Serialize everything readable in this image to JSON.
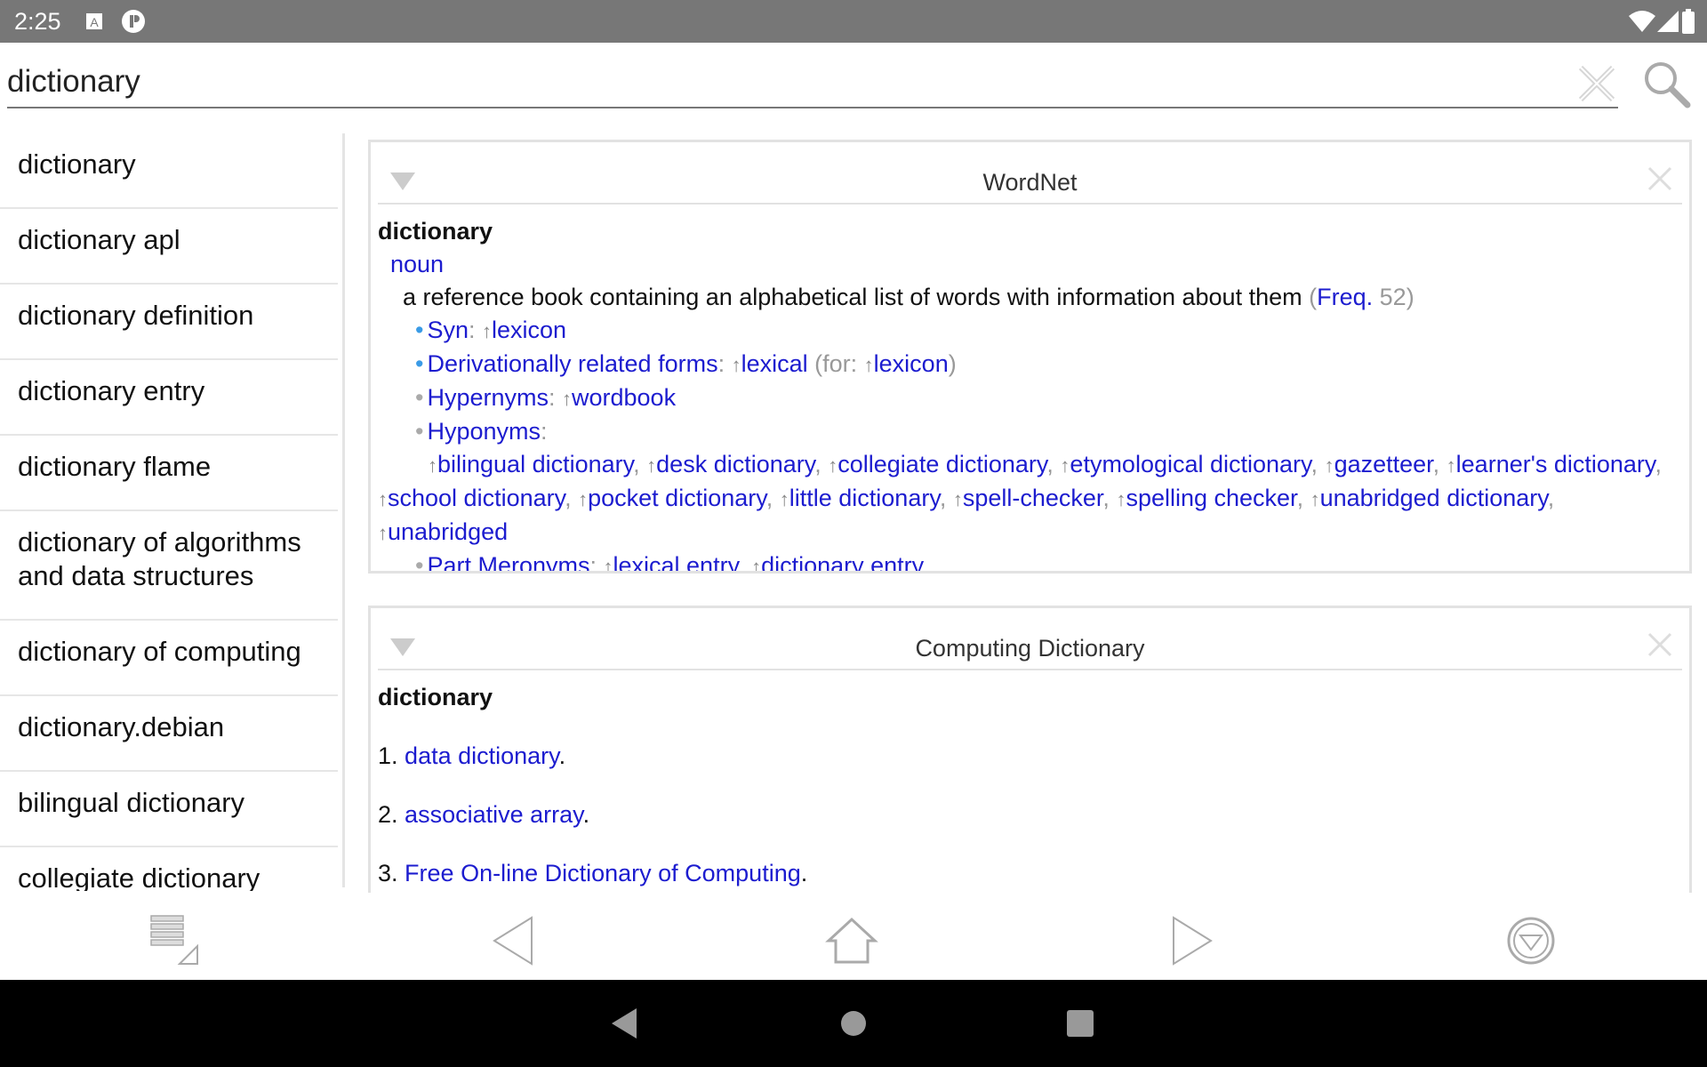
{
  "status": {
    "time": "2:25",
    "icons": [
      "a-notification-icon",
      "p-notification-icon",
      "wifi-icon",
      "signal-icon",
      "battery-icon"
    ]
  },
  "search": {
    "value": "dictionary",
    "clear_icon": "clear-icon",
    "search_icon": "search-icon"
  },
  "sidebar": {
    "items": [
      "dictionary",
      "dictionary apl",
      "dictionary definition",
      "dictionary entry",
      "dictionary flame",
      "dictionary of algorithms and data structures",
      "dictionary of computing",
      "dictionary.debian",
      "bilingual dictionary",
      "collegiate dictionary"
    ]
  },
  "wordnet": {
    "title": "WordNet",
    "headword": "dictionary",
    "pos": "noun",
    "definition": "a reference book containing an alphabetical list of words with information about them",
    "freq_label": "Freq.",
    "freq_value": "52",
    "syn_label": "Syn",
    "syn": "lexicon",
    "deriv_label": "Derivationally related forms",
    "deriv": "lexical",
    "deriv_for": "for:",
    "deriv_for_word": "lexicon",
    "hyper_label": "Hypernyms",
    "hyper": "wordbook",
    "hypo_label": "Hyponyms",
    "hyponyms": [
      "bilingual dictionary",
      "desk dictionary",
      "collegiate dictionary",
      "etymological dictionary",
      "gazetteer",
      "learner's dictionary",
      "school dictionary",
      "pocket dictionary",
      "little dictionary",
      "spell-checker",
      "spelling checker",
      "unabridged dictionary",
      "unabridged"
    ],
    "mero_label": "Part Meronyms",
    "meronyms": [
      "lexical entry",
      "dictionary entry"
    ]
  },
  "computing": {
    "title": "Computing Dictionary",
    "headword": "dictionary",
    "entries": [
      {
        "num": "1.",
        "link": "data dictionary"
      },
      {
        "num": "2.",
        "link": "associative array"
      },
      {
        "num": "3.",
        "link": "Free On-line Dictionary of Computing"
      }
    ]
  },
  "toolbar": {
    "icons": [
      "history-list-icon",
      "back-icon",
      "home-icon",
      "forward-icon",
      "collapse-all-icon"
    ]
  },
  "colors": {
    "link": "#1c1ccf",
    "status_bar": "#777777"
  }
}
